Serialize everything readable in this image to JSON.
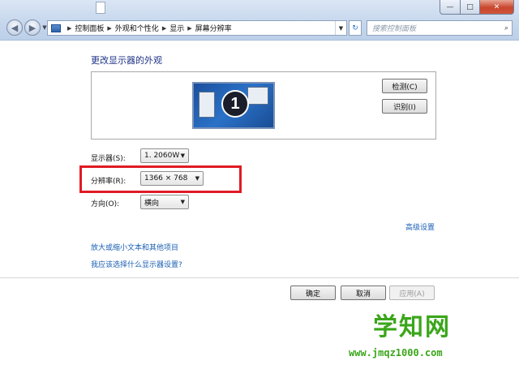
{
  "window": {
    "minimize": "—",
    "maximize": "□",
    "close": "✕"
  },
  "nav": {
    "back_icon": "back-arrow-icon",
    "forward_icon": "forward-arrow-icon"
  },
  "address": {
    "crumbs": [
      "控制面板",
      "外观和个性化",
      "显示",
      "屏幕分辨率"
    ]
  },
  "search": {
    "placeholder": "搜索控制面板"
  },
  "page": {
    "title": "更改显示器的外观"
  },
  "preview": {
    "monitor_number": "1",
    "detect_label": "检测(C)",
    "identify_label": "识别(I)"
  },
  "settings": {
    "display_label": "显示器(S):",
    "display_value": "1. 2060W",
    "resolution_label": "分辨率(R):",
    "resolution_value": "1366 × 768",
    "orientation_label": "方向(O):",
    "orientation_value": "横向"
  },
  "links": {
    "advanced": "高级设置",
    "enlarge_text": "放大或缩小文本和其他项目",
    "which_settings": "我应该选择什么显示器设置?"
  },
  "footer": {
    "ok_label": "确定",
    "cancel_label": "取消",
    "apply_label": "应用(A)"
  },
  "watermark": {
    "brand": "学知网",
    "url": "www.jmqz1000.com"
  },
  "colors": {
    "highlight": "#e01b24",
    "link": "#1a5fb4",
    "heading": "#1e3287",
    "watermark": "#3aa61a"
  }
}
